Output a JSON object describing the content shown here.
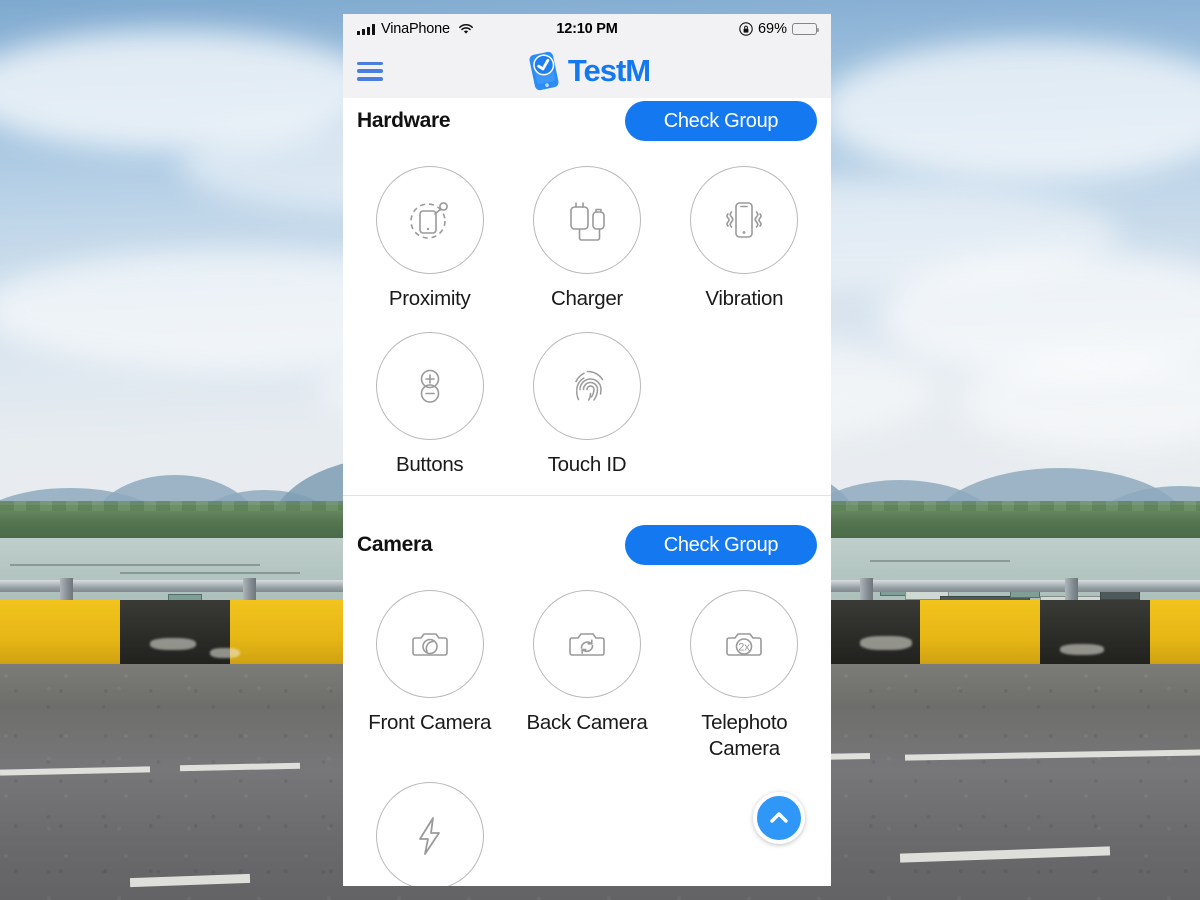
{
  "background": {
    "scene_description": "Photo of a coastal bridge road with guardrail, yellow and black concrete barrier, water, floating huts, treeline and distant mountains under a cloudy blue sky"
  },
  "status_bar": {
    "carrier": "VinaPhone",
    "wifi_icon": "wifi-icon",
    "signal_icon": "cellular-signal-icon",
    "time": "12:10 PM",
    "rotation_lock_icon": "rotation-lock-icon",
    "battery_percent": "69%",
    "battery_level": 69,
    "battery_icon": "battery-icon"
  },
  "nav_bar": {
    "menu_icon": "hamburger-menu-icon",
    "logo_icon": "testm-logo-icon",
    "brand_name": "TestM"
  },
  "theme": {
    "accent_blue": "#1478f0",
    "fab_blue": "#2f97f7",
    "circle_outline": "#b9b9b9",
    "status_bar_bg": "#f2f2f4"
  },
  "groups": [
    {
      "title": "Hardware",
      "check_button_label": "Check Group",
      "tiles": [
        {
          "label": "Proximity",
          "icon": "proximity-sensor-icon"
        },
        {
          "label": "Charger",
          "icon": "charger-plug-icon"
        },
        {
          "label": "Vibration",
          "icon": "phone-vibration-icon"
        },
        {
          "label": "Buttons",
          "icon": "volume-buttons-icon"
        },
        {
          "label": "Touch ID",
          "icon": "fingerprint-icon"
        }
      ]
    },
    {
      "title": "Camera",
      "check_button_label": "Check Group",
      "tiles": [
        {
          "label": "Front Camera",
          "icon": "front-camera-icon"
        },
        {
          "label": "Back Camera",
          "icon": "back-camera-icon"
        },
        {
          "label": "Telephoto Camera",
          "icon": "telephoto-camera-icon",
          "badge": "2x"
        },
        {
          "label": "",
          "icon": "camera-flash-icon"
        }
      ]
    }
  ],
  "scroll_top_button": {
    "icon": "chevron-up-icon",
    "label": "Scroll to top"
  }
}
